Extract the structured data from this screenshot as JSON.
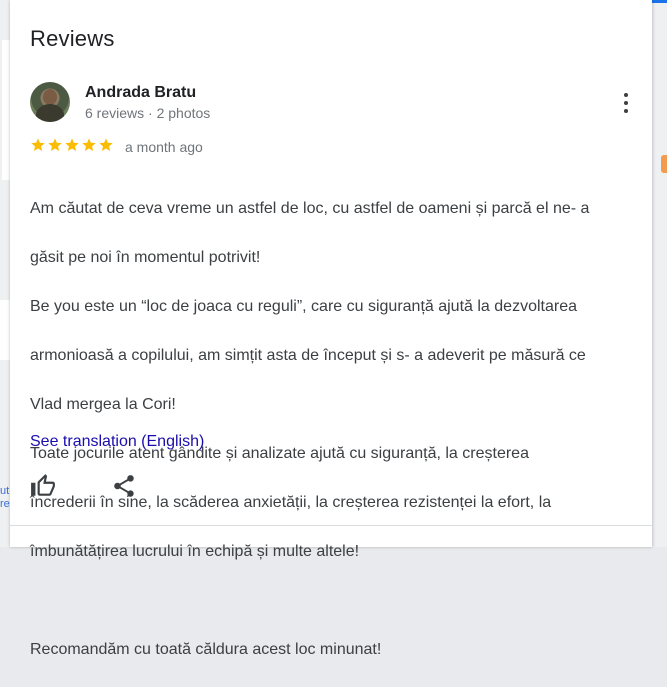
{
  "header": {
    "title": "Reviews"
  },
  "review": {
    "author": "Andrada Bratu",
    "author_meta": "6 reviews · 2 photos",
    "rating": 5,
    "rating_max": 5,
    "date": "a month ago",
    "lines": [
      "Am căutat de ceva vreme un astfel de loc, cu astfel de oameni și parcă el ne- a",
      "găsit pe noi în momentul potrivit!",
      "Be you este un “loc de joaca cu reguli”, care cu siguranță ajută la dezvoltarea",
      "armonioasă a copilului, am simțit asta de început și s- a adeverit pe măsură ce",
      "Vlad mergea la Cori!",
      "Toate jocurile atent gândite și analizate ajută cu siguranță, la creșterea",
      "încrederii în sine, la scăderea anxietății, la creșterea rezistenței la efort, la",
      "îmbunătățirea lucrului în echipă și multe altele!",
      "",
      "Recomandăm cu toată căldura acest loc minunat!"
    ],
    "translate_label": "See translation (English)"
  },
  "icons": {
    "star": "star-icon",
    "more": "more-vert-icon",
    "like": "thumb-up-icon",
    "share": "share-icon"
  },
  "colors": {
    "star": "#fbbc04",
    "link": "#1a0dab",
    "accent": "#1a73e8"
  }
}
